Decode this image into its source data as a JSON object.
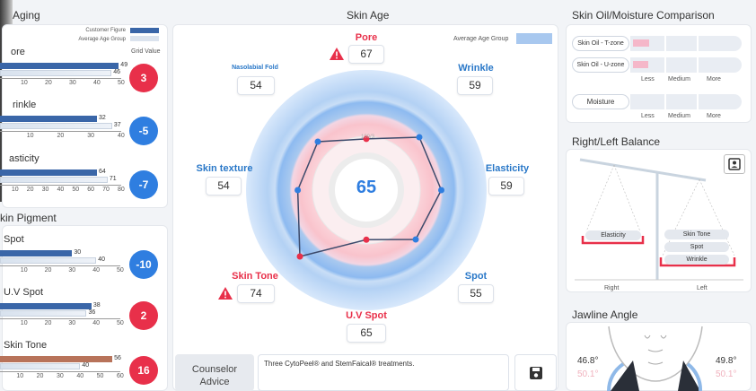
{
  "aging": {
    "title": "Aging",
    "legend": {
      "customer": "Customer Figure",
      "average": "Average Age Group",
      "grid": "Grid Value"
    },
    "items": [
      {
        "label": "ore",
        "customer": 49,
        "average": 46,
        "diff": "3",
        "diff_color": "red",
        "ticks": [
          "10",
          "20",
          "30",
          "40",
          "50"
        ]
      },
      {
        "label": "rinkle",
        "customer": 32,
        "average": 37,
        "diff": "-5",
        "diff_color": "blue",
        "ticks": [
          "10",
          "20",
          "30",
          "40"
        ]
      },
      {
        "label": "asticity",
        "customer": 64,
        "average": 71,
        "diff": "-7",
        "diff_color": "blue",
        "ticks": [
          "10",
          "20",
          "30",
          "40",
          "50",
          "60",
          "70",
          "80"
        ]
      }
    ]
  },
  "pigment": {
    "title": "kin Pigment",
    "items": [
      {
        "label": "Spot",
        "customer": 30,
        "average": 40,
        "diff": "-10",
        "diff_color": "blue",
        "ticks": [
          "0",
          "10",
          "20",
          "30",
          "40",
          "50"
        ]
      },
      {
        "label": "U.V Spot",
        "customer": 38,
        "average": 36,
        "diff": "2",
        "diff_color": "red",
        "ticks": [
          "0",
          "10",
          "20",
          "30",
          "40",
          "50"
        ]
      },
      {
        "label": "Skin Tone",
        "customer": 56,
        "average": 40,
        "diff": "16",
        "diff_color": "red",
        "ticks": [
          "0",
          "10",
          "20",
          "30",
          "40",
          "50",
          "60"
        ]
      }
    ]
  },
  "skin_age": {
    "title": "Skin Age",
    "legend": "Average Age Group",
    "score": "65",
    "ring_labels": [
      "100/3",
      "75",
      "25",
      "50",
      "75"
    ],
    "categories": [
      {
        "name": "Pore",
        "value": "67",
        "warn": true
      },
      {
        "name": "Wrinkle",
        "value": "59",
        "warn": false
      },
      {
        "name": "Elasticity",
        "value": "59",
        "warn": false
      },
      {
        "name": "Spot",
        "value": "55",
        "warn": false
      },
      {
        "name": "U.V Spot",
        "value": "65",
        "warn": false
      },
      {
        "name": "Skin Tone",
        "value": "74",
        "warn": true
      },
      {
        "name": "Skin texture",
        "value": "54",
        "warn": false
      },
      {
        "name": "Nasolabial Fold",
        "value": "54",
        "warn": false
      }
    ]
  },
  "counselor": {
    "label_line1": "Counselor",
    "label_line2": "Advice",
    "text": "Three CytoPeel® and StemFaical® treatments."
  },
  "oil_moisture": {
    "title": "Skin Oil/Moisture Comparison",
    "rows": [
      {
        "label": "Skin Oil - T-zone"
      },
      {
        "label": "Skin Oil - U-zone"
      }
    ],
    "moisture_label": "Moisture",
    "scale": [
      "Less",
      "Medium",
      "More"
    ]
  },
  "balance": {
    "title": "Right/Left Balance",
    "right_item": "Elasticity",
    "left_items": [
      "Skin Tone",
      "Spot",
      "Wrinkle"
    ],
    "right_label": "Right",
    "left_label": "Left"
  },
  "jawline": {
    "title": "Jawline Angle",
    "left_value": "46.8°",
    "left_avg": "50.1°",
    "right_value": "49.8°",
    "right_avg": "50.1°"
  },
  "colors": {
    "red": "#e8304a",
    "blue": "#2f7ee0",
    "bar_dark": "#3a66a8",
    "bar_tone": "#b8735a"
  }
}
